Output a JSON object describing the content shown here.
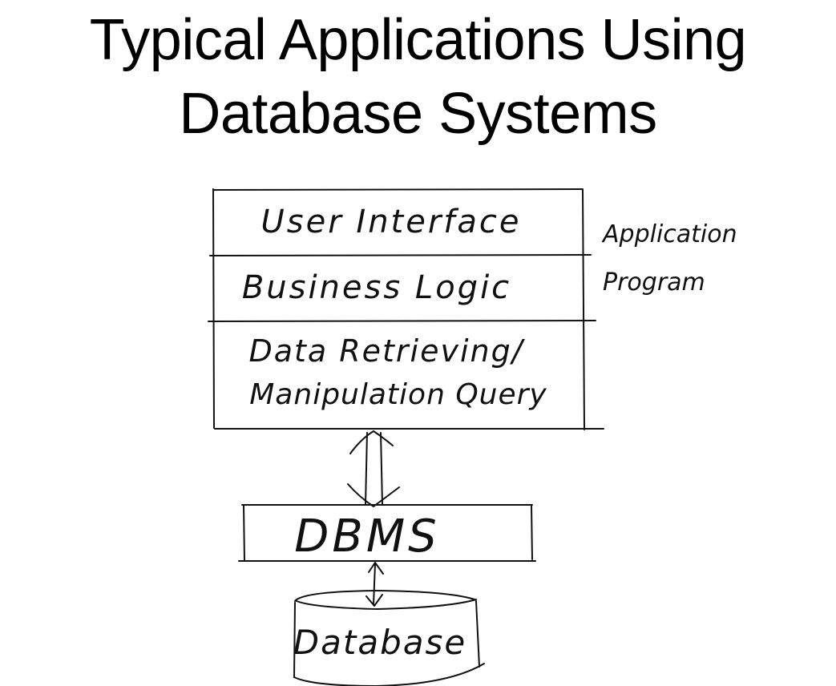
{
  "title": {
    "line1": "Typical Applications Using",
    "line2": "Database Systems"
  },
  "diagram": {
    "layers": [
      {
        "label": "User Interface"
      },
      {
        "label": "Business Logic"
      },
      {
        "label_line1": "Data Retrieving/",
        "label_line2": "Manipulation Query"
      }
    ],
    "side_label": {
      "line1": "Application",
      "line2": "Program"
    },
    "dbms_label": "DBMS",
    "database_label": "Database"
  }
}
